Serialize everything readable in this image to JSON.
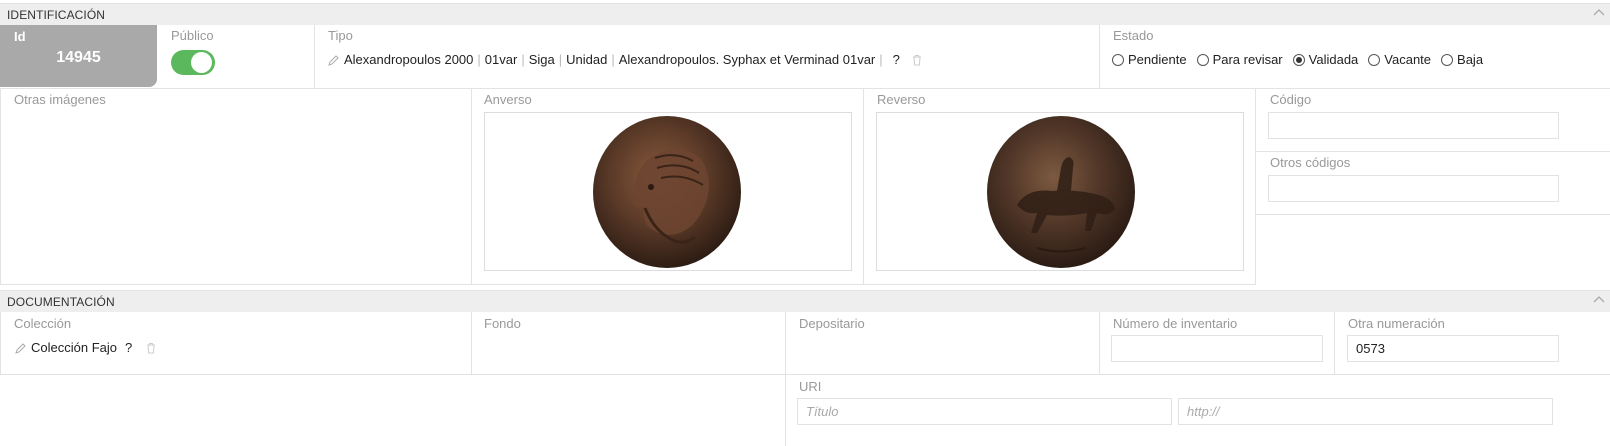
{
  "identificacion": {
    "title": "IDENTIFICACIÓN",
    "id_label": "Id",
    "id_value": "14945",
    "publico_label": "Público",
    "publico_on": true,
    "tipo_label": "Tipo",
    "tipo_parts": [
      "Alexandropoulos 2000",
      "01var",
      "Siga",
      "Unidad",
      "Alexandropoulos. Syphax et Verminad 01var"
    ],
    "tipo_help": "?",
    "estado_label": "Estado",
    "estado_options": [
      {
        "label": "Pendiente",
        "checked": false
      },
      {
        "label": "Para revisar",
        "checked": false
      },
      {
        "label": "Validada",
        "checked": true
      },
      {
        "label": "Vacante",
        "checked": false
      },
      {
        "label": "Baja",
        "checked": false
      }
    ],
    "otras_imagenes_label": "Otras imágenes",
    "anverso_label": "Anverso",
    "reverso_label": "Reverso",
    "codigo_label": "Código",
    "codigo_value": "",
    "otros_codigos_label": "Otros códigos",
    "otros_codigos_value": ""
  },
  "documentacion": {
    "title": "DOCUMENTACIÓN",
    "coleccion_label": "Colección",
    "coleccion_value": "Colección Fajo",
    "coleccion_help": "?",
    "fondo_label": "Fondo",
    "depositario_label": "Depositario",
    "inventario_label": "Número de inventario",
    "inventario_value": "",
    "otra_numeracion_label": "Otra numeración",
    "otra_numeracion_value": "0573",
    "uri_label": "URI",
    "uri_title_placeholder": "Título",
    "uri_url_placeholder": "http://"
  },
  "colors": {
    "toggle_on": "#5cb85c",
    "id_box": "#a9a9a9",
    "section_bar": "#eeeeee"
  }
}
